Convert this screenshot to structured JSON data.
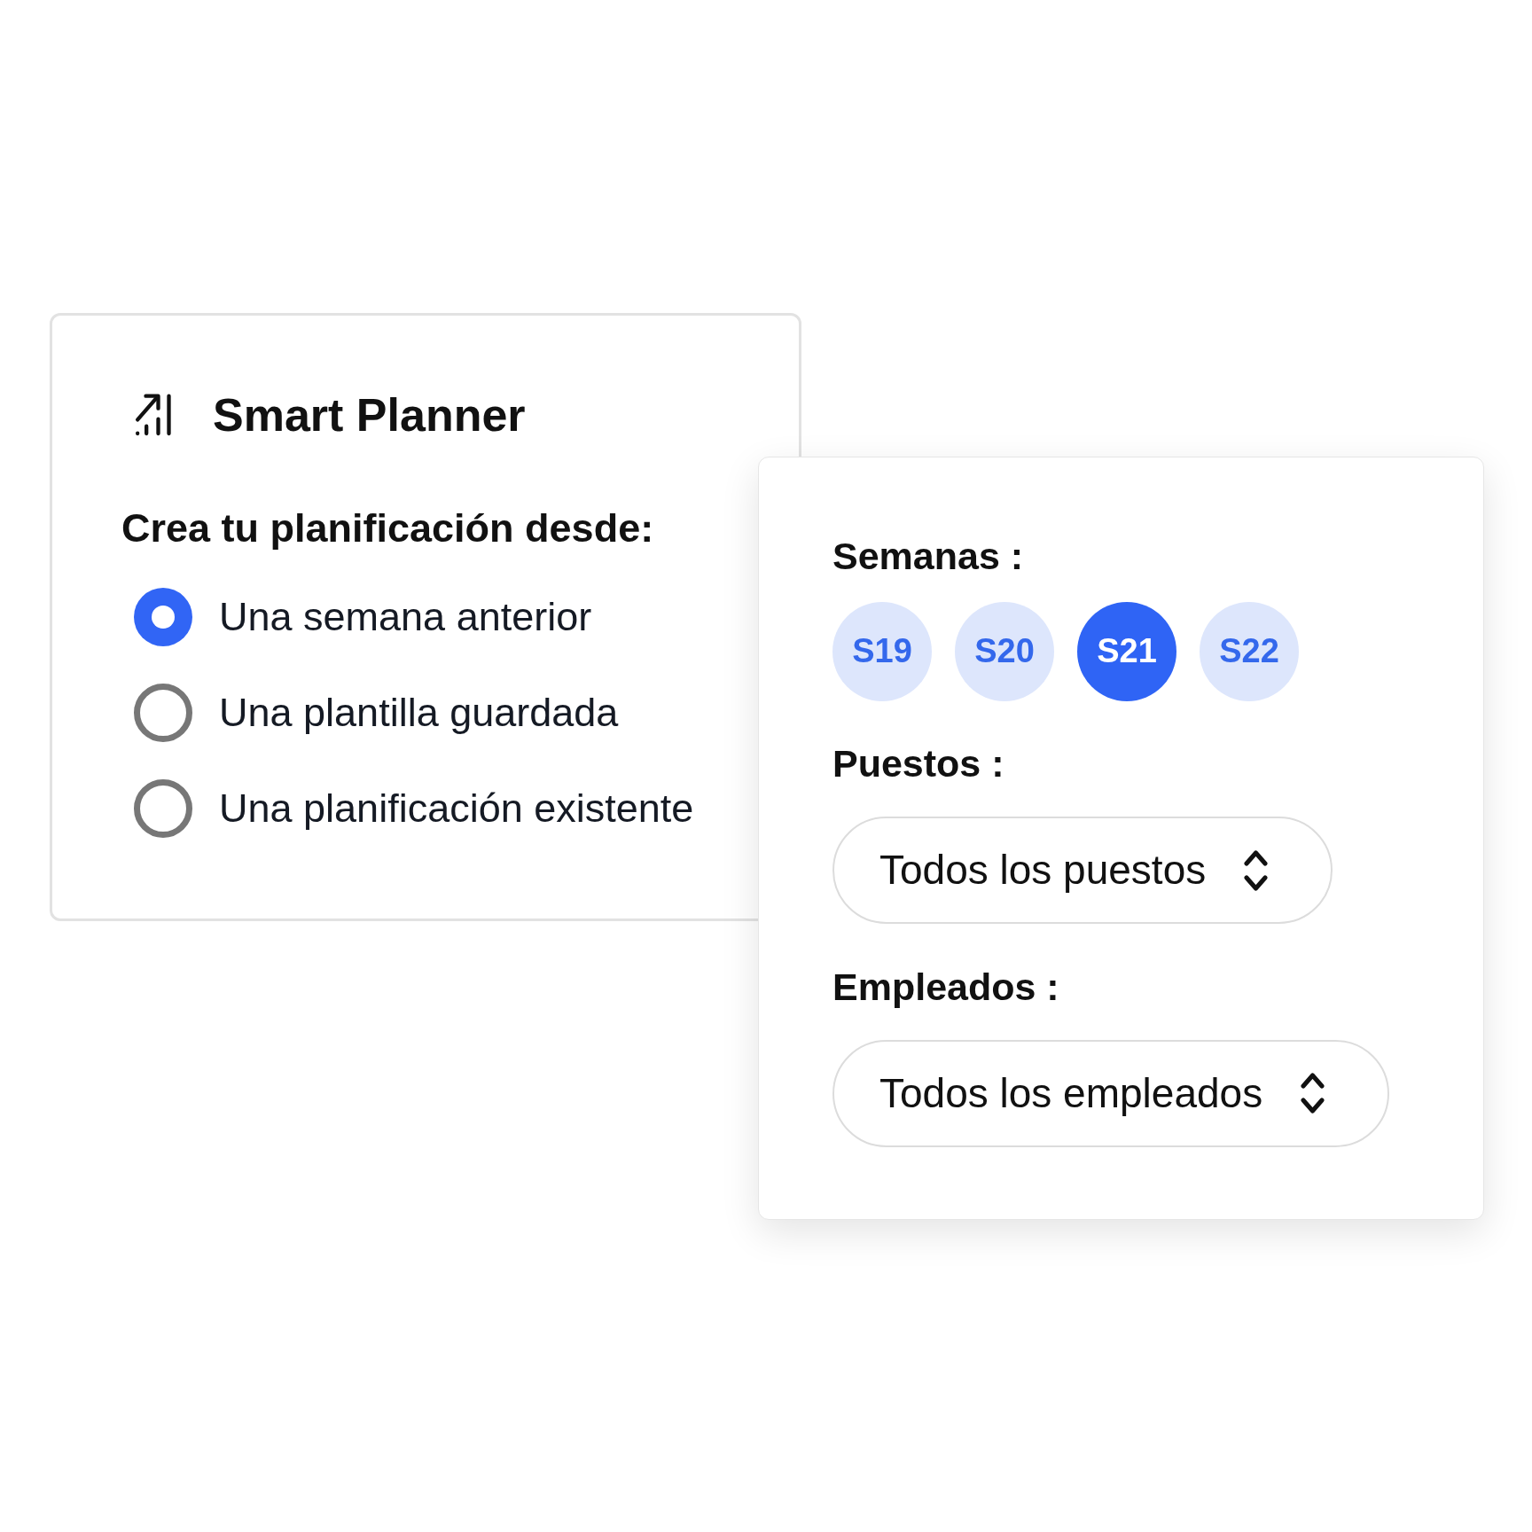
{
  "card": {
    "title": "Smart Planner",
    "subtitle": "Crea tu planificación desde:",
    "options": [
      {
        "label": "Una semana anterior",
        "selected": true
      },
      {
        "label": "Una plantilla guardada",
        "selected": false
      },
      {
        "label": "Una planificación existente",
        "selected": false
      }
    ]
  },
  "filters": {
    "weeks": {
      "label": "Semanas :",
      "items": [
        {
          "label": "S19",
          "selected": false
        },
        {
          "label": "S20",
          "selected": false
        },
        {
          "label": "S21",
          "selected": true
        },
        {
          "label": "S22",
          "selected": false
        }
      ]
    },
    "positions": {
      "label": "Puestos :",
      "value": "Todos los puestos"
    },
    "employees": {
      "label": "Empleados :",
      "value": "Todos los empleados"
    }
  }
}
